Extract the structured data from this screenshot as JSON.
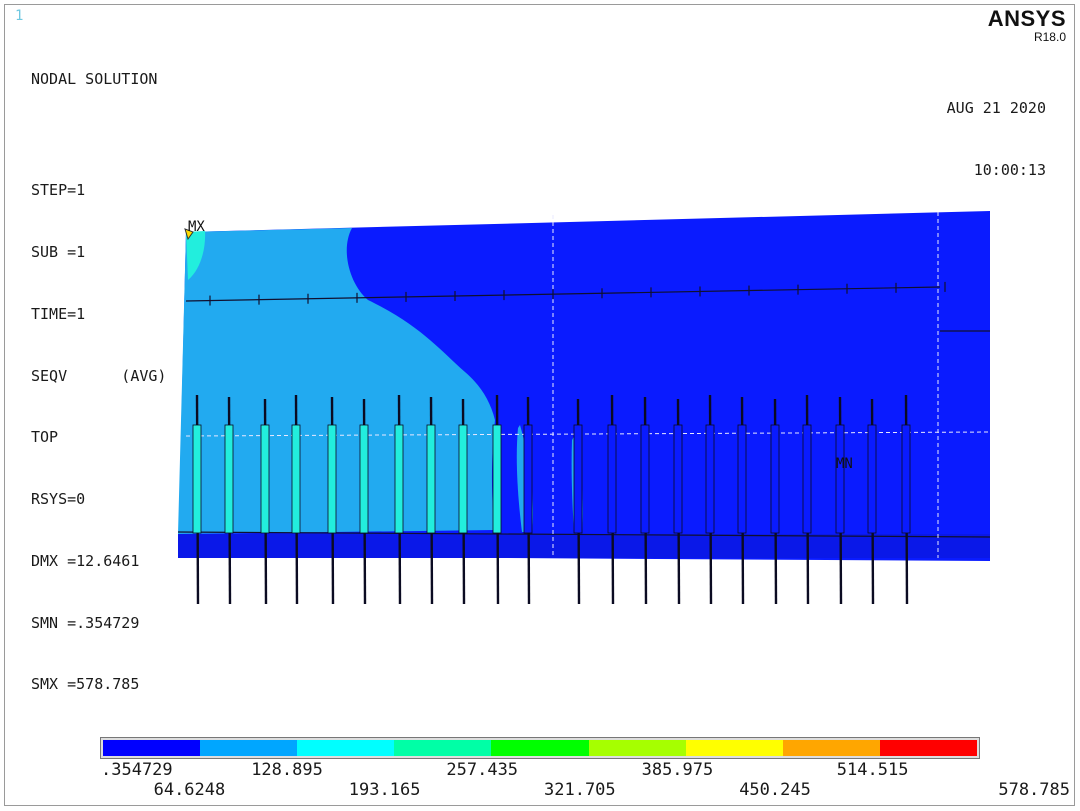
{
  "window": {
    "number": "1"
  },
  "logo": {
    "brand": "ANSYS",
    "release": "R18.0"
  },
  "info": {
    "title": "NODAL SOLUTION",
    "step": "STEP=1",
    "sub": "SUB =1",
    "time": "TIME=1",
    "result": "SEQV      (AVG)",
    "layer": "TOP",
    "rsys": "RSYS=0",
    "dmx": "DMX =12.6461",
    "smn": "SMN =.354729",
    "smx": "SMX =578.785"
  },
  "stamp": {
    "date": "AUG 21 2020",
    "time": "10:00:13"
  },
  "markers": {
    "max": "MX",
    "min": "MN"
  },
  "legend": {
    "colors": [
      "#0000ff",
      "#00a6ff",
      "#00ffff",
      "#00ffa6",
      "#00ff00",
      "#a6ff00",
      "#ffff00",
      "#ffa600",
      "#ff0000"
    ],
    "values": [
      ".354729",
      "64.6248",
      "128.895",
      "193.165",
      "257.435",
      "321.705",
      "385.975",
      "450.245",
      "514.515",
      "578.785"
    ]
  },
  "colors": {
    "contour_dark": "#0a1bff",
    "contour_light": "#22aaf0",
    "contour_cyan": "#22eedd"
  }
}
